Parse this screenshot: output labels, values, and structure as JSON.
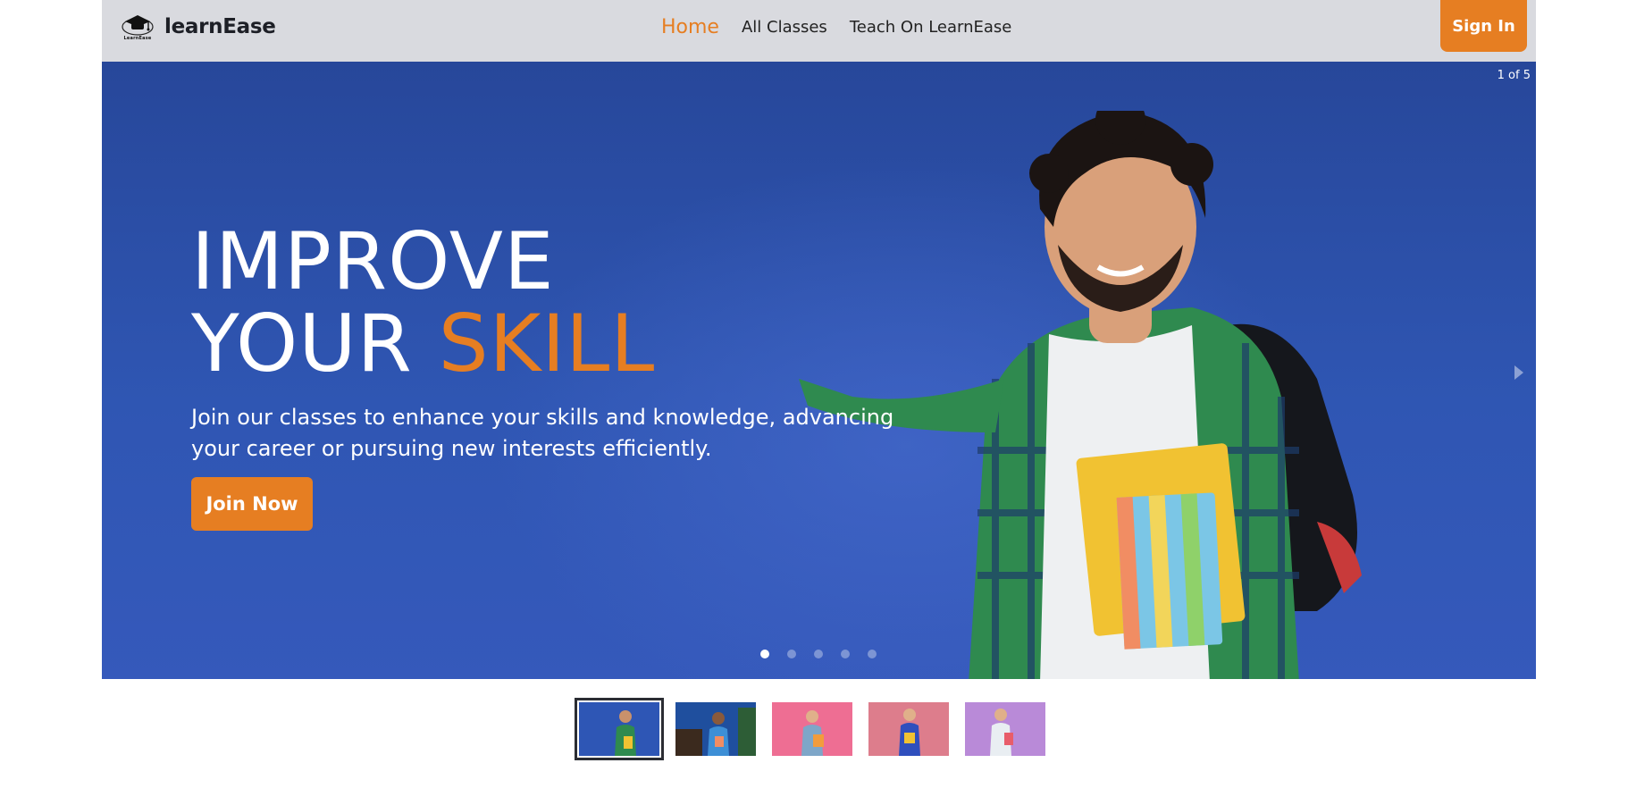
{
  "nav": {
    "brand_name": "learnEase",
    "logo_text": "LearnEase",
    "links": [
      {
        "label": "Home",
        "active": true
      },
      {
        "label": "All Classes",
        "active": false
      },
      {
        "label": "Teach On LearnEase",
        "active": false
      }
    ],
    "signin_label": "Sign In"
  },
  "hero": {
    "counter": "1 of 5",
    "title_line1": "IMPROVE",
    "title_line2_prefix": "YOUR",
    "title_line2_accent": "SKILL",
    "subtitle": "Join our classes to enhance your skills and knowledge, advancing your career or pursuing new interests efficiently.",
    "cta_label": "Join Now",
    "total_slides": 5,
    "active_slide": 1
  },
  "thumbnails": [
    {
      "bg": "#2e56b5",
      "active": true
    },
    {
      "bg": "#1f4f9e",
      "active": false
    },
    {
      "bg": "#ee6e93",
      "active": false
    },
    {
      "bg": "#dd7d8c",
      "active": false
    },
    {
      "bg": "#b98ad8",
      "active": false
    }
  ],
  "colors": {
    "accent": "#e67e22",
    "navbar_bg": "#d9dadf",
    "hero_bg": "#2f56b3"
  },
  "icons": {
    "logo": "graduation-cap-icon",
    "next": "chevron-right-icon"
  }
}
